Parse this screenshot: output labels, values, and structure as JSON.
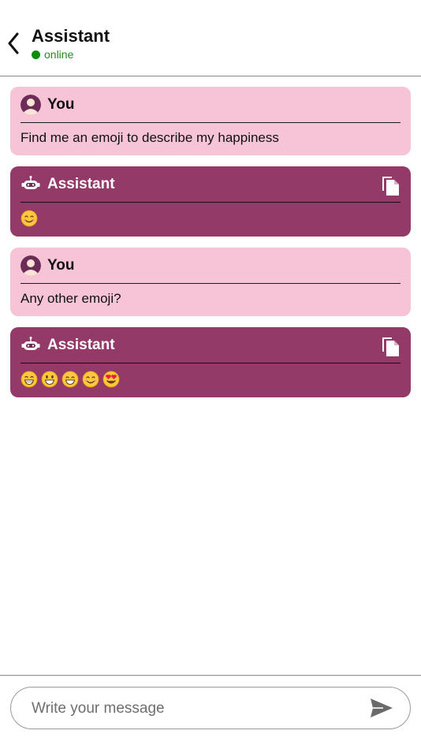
{
  "header": {
    "title": "Assistant",
    "status": "online",
    "status_color": "#0c8d0c"
  },
  "colors": {
    "user_bubble": "#f7c3d6",
    "assistant_bubble": "#943a69"
  },
  "messages": [
    {
      "sender": "You",
      "role": "user",
      "text": "Find me an emoji to describe my happiness"
    },
    {
      "sender": "Assistant",
      "role": "assistant",
      "emojis": [
        "smiling-face-with-smiling-eyes"
      ]
    },
    {
      "sender": "You",
      "role": "user",
      "text": "Any other emoji?"
    },
    {
      "sender": "Assistant",
      "role": "assistant",
      "emojis": [
        "beaming-face",
        "grinning-face-big-eyes",
        "grinning-face-smiling-eyes",
        "smiling-face-with-smiling-eyes",
        "heart-eyes-face"
      ]
    }
  ],
  "composer": {
    "placeholder": "Write your message",
    "value": ""
  },
  "icons": {
    "back": "chevron-left-icon",
    "copy": "copy-icon",
    "send": "send-icon",
    "user_avatar": "user-avatar-icon",
    "bot_avatar": "robot-avatar-icon"
  }
}
